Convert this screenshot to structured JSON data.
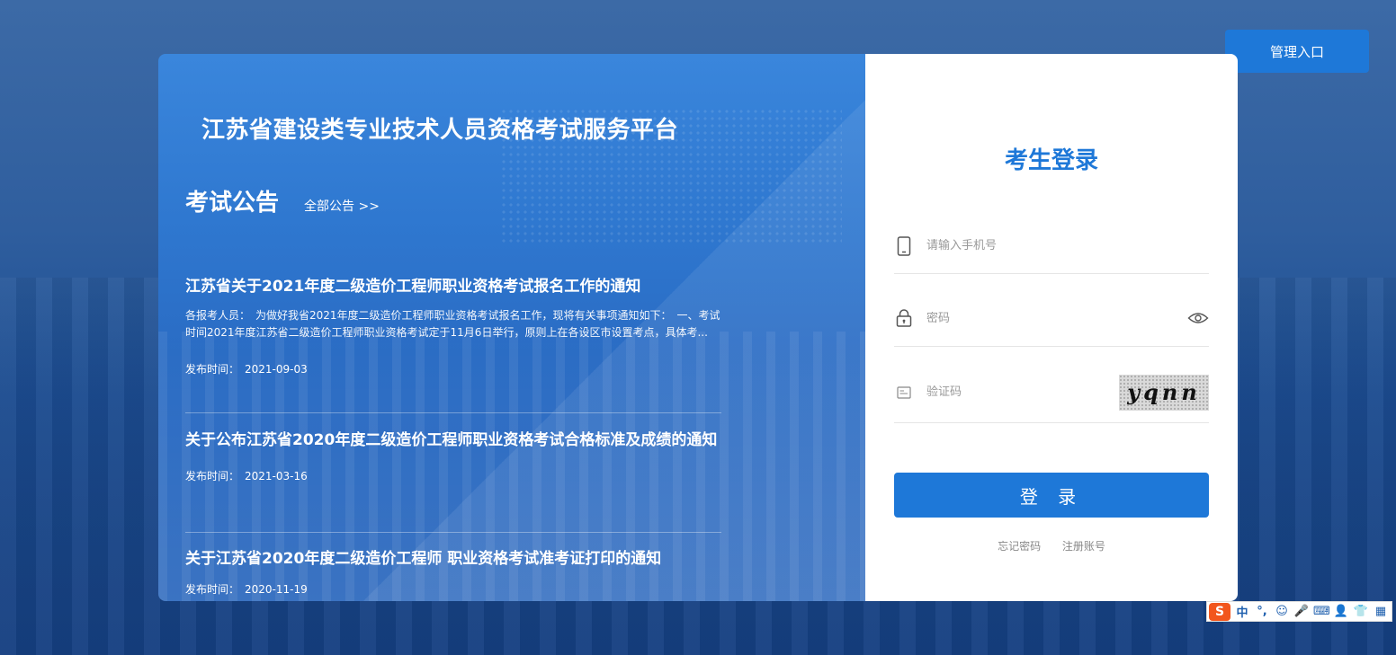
{
  "admin_button": "管理入口",
  "platform_title": "江苏省建设类专业技术人员资格考试服务平台",
  "notices": {
    "title": "考试公告",
    "all_link": "全部公告 >>",
    "date_label": "发布时间：",
    "items": [
      {
        "title": "江苏省关于2021年度二级造价工程师职业资格考试报名工作的通知",
        "summary": "各报考人员：　为做好我省2021年度二级造价工程师职业资格考试报名工作，现将有关事项通知如下：　一、考试时间2021年度江苏省二级造价工程师职业资格考试定于11月6日举行，原则上在各设区市设置考点，具体考...",
        "date": "2021-09-03"
      },
      {
        "title": "关于公布江苏省2020年度二级造价工程师职业资格考试合格标准及成绩的通知",
        "summary": "",
        "date": "2021-03-16"
      },
      {
        "title": "关于江苏省2020年度二级造价工程师 职业资格考试准考证打印的通知",
        "summary": "",
        "date": "2020-11-19"
      }
    ]
  },
  "login": {
    "title": "考生登录",
    "phone_placeholder": "请输入手机号",
    "password_placeholder": "密码",
    "captcha_placeholder": "验证码",
    "captcha_text": "yqnn",
    "submit": "登 录",
    "forgot": "忘记密码",
    "register": "注册账号"
  },
  "ime_toolbar": {
    "logo": "S",
    "items": [
      "中",
      "°,",
      "☺",
      "🎤",
      "⌨",
      "👤",
      "👕",
      "▦"
    ]
  },
  "colors": {
    "accent": "#1e78d8",
    "left_panel": "#2f78d0",
    "ime_logo": "#f2561d"
  }
}
